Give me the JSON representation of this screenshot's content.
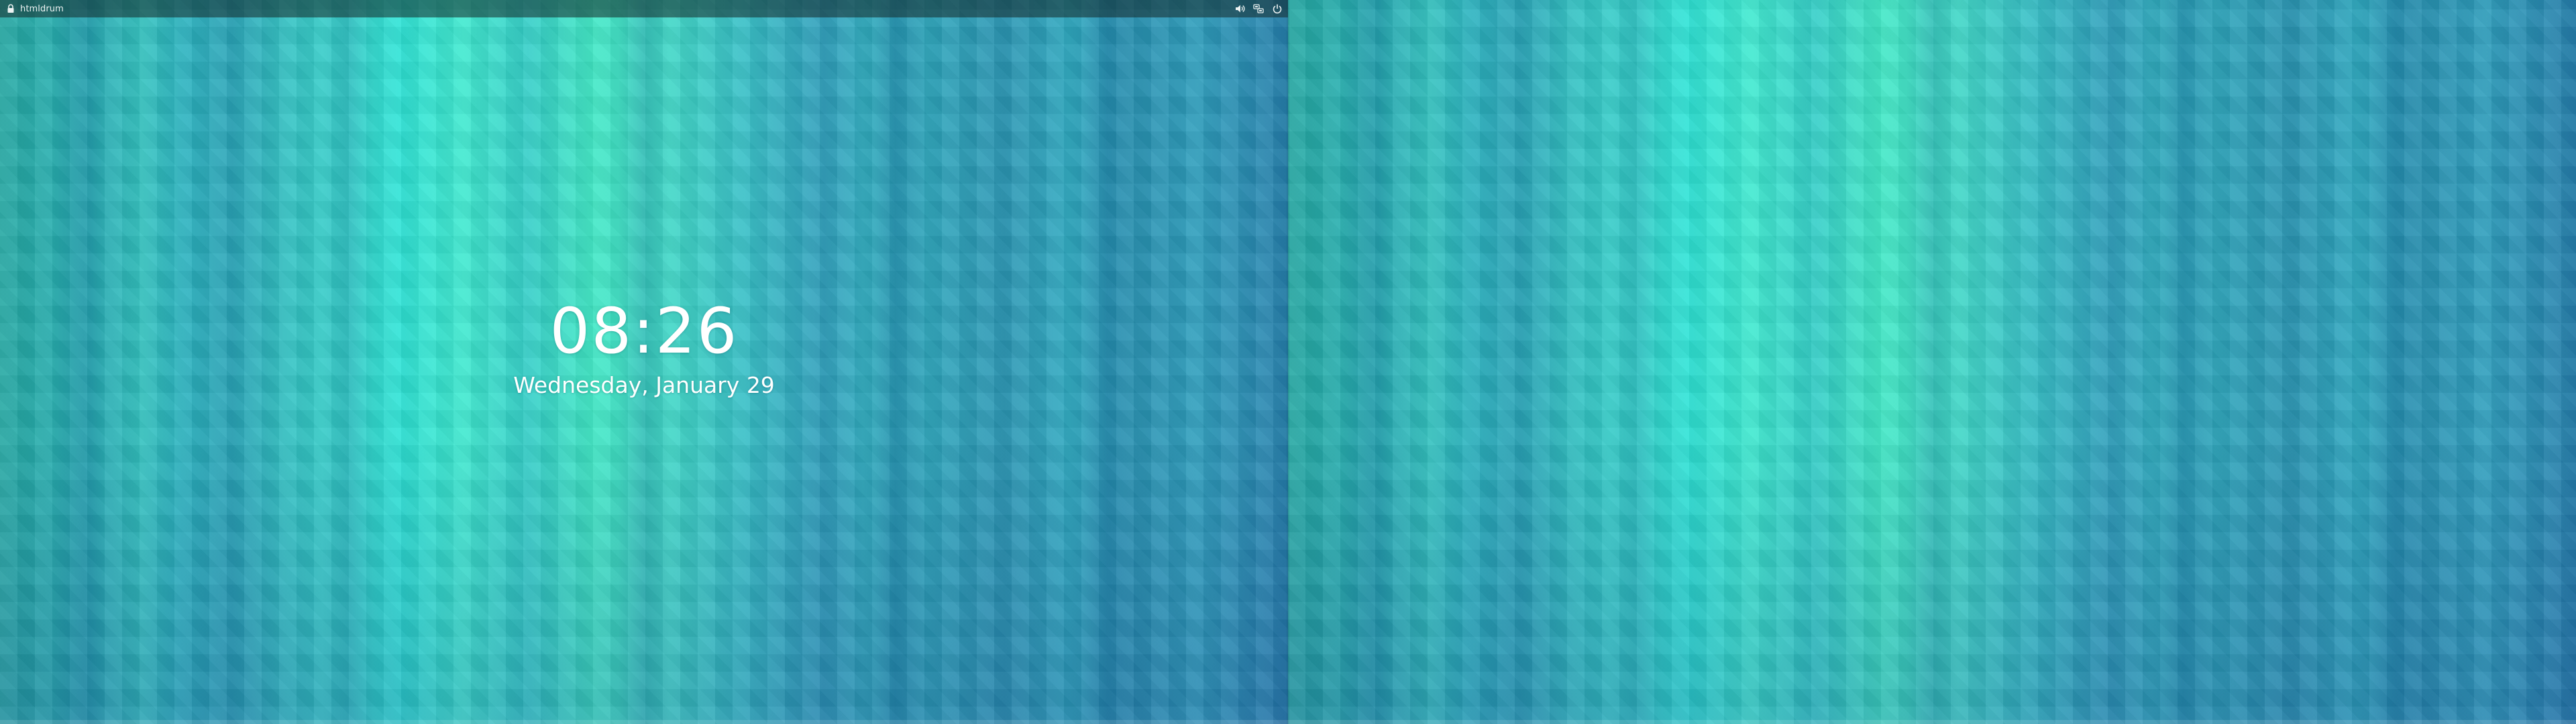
{
  "top_bar": {
    "lock_icon": "lock-icon",
    "host_name": "htmldrum",
    "tray_icons": [
      "volume-icon",
      "network-icon",
      "power-icon"
    ]
  },
  "lock_screen": {
    "time": "08:26",
    "date": "Wednesday, January 29"
  },
  "colors": {
    "top_bar_bg": "#142828",
    "text": "#ffffff",
    "wallpaper_accent": "#3fe9d0",
    "wallpaper_base": "#2aa5b8"
  }
}
